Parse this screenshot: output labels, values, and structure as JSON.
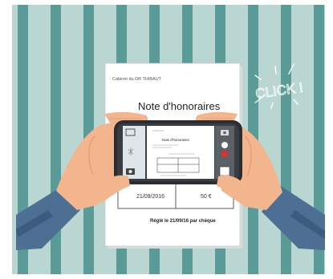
{
  "document": {
    "clinic": "Cabinet du DR THIBAUT",
    "title": "Note d'honoraires",
    "date": "21/09/2016",
    "amount": "50 €",
    "payment_note": "Réglé le 21/09/16 par chèque"
  },
  "phone_screen": {
    "doc_title": "Note d'honoraires"
  },
  "sound_effect": "CLICK !",
  "colors": {
    "stripe_light": "#b9d6d3",
    "stripe_dark": "#5a9b98",
    "paper": "#ffffff",
    "skin": "#f3b58e",
    "skin_shadow": "#e29b73",
    "sleeve": "#4d6f93",
    "phone": "#2b2d31"
  },
  "icons": [
    "camera-icon",
    "flash-icon",
    "gallery-icon",
    "shutter-icon",
    "record-icon",
    "settings-icon"
  ]
}
